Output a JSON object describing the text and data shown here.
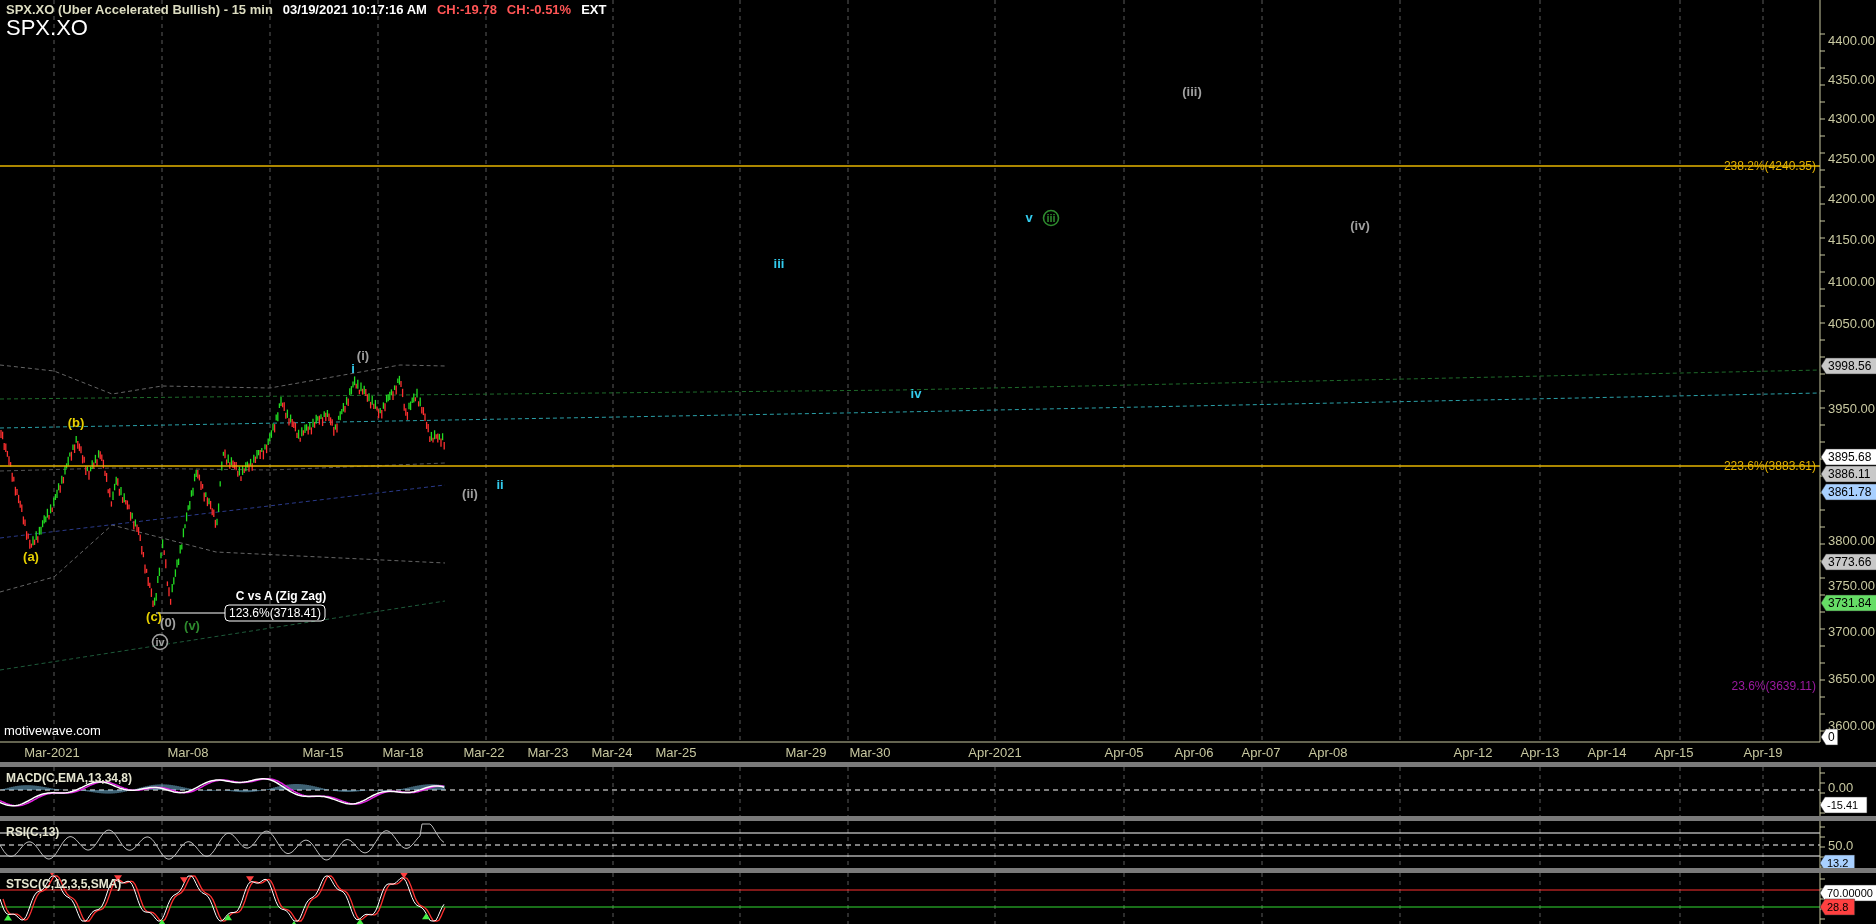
{
  "header": {
    "title": "SPX.XO (Uber Accelerated Bullish) - 15 min",
    "timestamp": "03/19/2021 10:17:16 AM",
    "change": "CH:-19.78",
    "change_percent": "CH:-0.51%",
    "session": "EXT",
    "symbol": "SPX.XO"
  },
  "price_chart": {
    "price_axis": {
      "ticks": [
        "4400.00",
        "4350.00",
        "4300.00",
        "4250.00",
        "4200.00",
        "4150.00",
        "4100.00",
        "4050.00",
        "3950.00",
        "3800.00",
        "3750.00",
        "3700.00",
        "3650.00",
        "3600.00"
      ],
      "markers": [
        {
          "label": "3998.56",
          "color": "#c8c8c8"
        },
        {
          "label": "3895.68",
          "color": "#ffffff"
        },
        {
          "label": "3886.11",
          "color": "#c8c8c8"
        },
        {
          "label": "3861.78",
          "color": "#a8d0ff"
        },
        {
          "label": "3773.66",
          "color": "#c8c8c8"
        },
        {
          "label": "3731.84",
          "color": "#66dd66"
        },
        {
          "label": "0",
          "color": "#ffffff"
        }
      ]
    },
    "fib_levels": [
      {
        "label": "238.2%(4240.35)",
        "color": "#e6b400",
        "line": true
      },
      {
        "label": "223.6%(3883.61)",
        "color": "#e6b400",
        "line": true
      },
      {
        "label": "23.6%(3639.11)",
        "color": "#9b1aa0",
        "line": false
      }
    ],
    "wave_labels": [
      {
        "text": "(iii)",
        "color": "#a0a0a0",
        "kind": "plain"
      },
      {
        "text": "v",
        "color": "#33ccee",
        "kind": "plain"
      },
      {
        "text": "iii",
        "color": "#2e8b2e",
        "kind": "circled"
      },
      {
        "text": "(iv)",
        "color": "#a0a0a0",
        "kind": "plain"
      },
      {
        "text": "iii",
        "color": "#33ccee",
        "kind": "plain"
      },
      {
        "text": "iv",
        "color": "#33ccee",
        "kind": "plain"
      },
      {
        "text": "(i)",
        "color": "#a0a0a0",
        "kind": "plain"
      },
      {
        "text": "i",
        "color": "#33ccee",
        "kind": "plain"
      },
      {
        "text": "(b)",
        "color": "#e6d000",
        "kind": "plain"
      },
      {
        "text": "(a)",
        "color": "#e6d000",
        "kind": "plain"
      },
      {
        "text": "(c)",
        "color": "#e6d000",
        "kind": "plain"
      },
      {
        "text": "(0)",
        "color": "#a0a0a0",
        "kind": "plain"
      },
      {
        "text": "(v)",
        "color": "#2e8b2e",
        "kind": "plain"
      },
      {
        "text": "iv",
        "color": "#a0a0a0",
        "kind": "circled"
      },
      {
        "text": "(ii)",
        "color": "#a0a0a0",
        "kind": "plain"
      },
      {
        "text": "ii",
        "color": "#33ccee",
        "kind": "plain"
      }
    ],
    "annotation": {
      "title": "C vs A (Zig Zag)",
      "value": "123.6%(3718.41)"
    },
    "credit": "motivewave.com"
  },
  "date_axis": [
    "Mar-2021",
    "Mar-08",
    "Mar-15",
    "Mar-18",
    "Mar-22",
    "Mar-23",
    "Mar-24",
    "Mar-25",
    "Mar-29",
    "Mar-30",
    "Apr-2021",
    "Apr-05",
    "Apr-06",
    "Apr-07",
    "Apr-08",
    "Apr-12",
    "Apr-13",
    "Apr-14",
    "Apr-15",
    "Apr-19"
  ],
  "indicators": [
    {
      "kind": "macd",
      "title": "MACD(C,EMA,13,34,8)",
      "ticks": [
        "0.00"
      ],
      "markers": [
        {
          "label": "-15.41",
          "color": "#ffffff"
        }
      ]
    },
    {
      "kind": "rsi",
      "title": "RSI(C,13)",
      "ticks": [
        "50.0"
      ],
      "markers": [
        {
          "label": "13.2",
          "color": "#a8d0ff"
        }
      ]
    },
    {
      "kind": "stochastic",
      "title": "STSC(C,12,3,5,SMA)",
      "markers": [
        {
          "label": "70.00000",
          "color": "#ffffff"
        },
        {
          "label": "28.8",
          "color": "#ff4040"
        }
      ]
    }
  ]
}
